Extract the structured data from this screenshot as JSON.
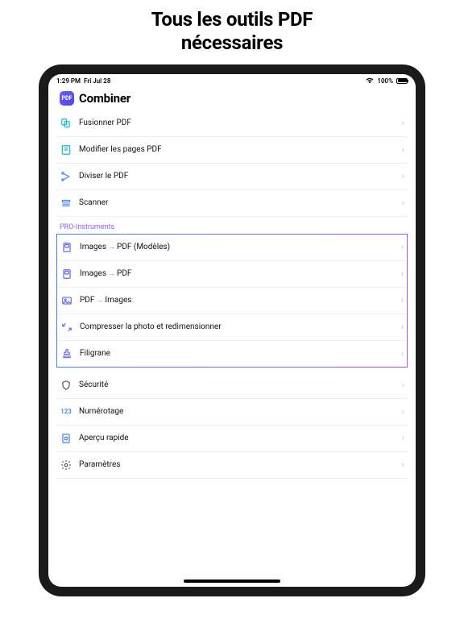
{
  "promo": {
    "title_line1": "Tous les outils PDF",
    "title_line2": "nécessaires"
  },
  "status": {
    "time": "1:29 PM",
    "date": "Fri Jul 28",
    "battery_pct": "100%"
  },
  "app": {
    "title": "Combiner",
    "icon_label": "PDF"
  },
  "basic_tools": [
    {
      "id": "merge",
      "label": "Fusionner PDF",
      "icon": "merge-icon"
    },
    {
      "id": "edit",
      "label": "Modifier les pages PDF",
      "icon": "edit-pages-icon"
    },
    {
      "id": "split",
      "label": "Diviser le PDF",
      "icon": "split-icon"
    },
    {
      "id": "scan",
      "label": "Scanner",
      "icon": "scanner-icon"
    }
  ],
  "pro_section": {
    "label": "PRO-Instruments",
    "tools": [
      {
        "id": "img2pdf_tpl",
        "label_a": "Images",
        "label_b": "PDF  (Modèles)",
        "icon": "image-doc-icon"
      },
      {
        "id": "img2pdf",
        "label_a": "Images",
        "label_b": "PDF",
        "icon": "image-doc-icon"
      },
      {
        "id": "pdf2img",
        "label_a": "PDF",
        "label_b": "Images",
        "icon": "picture-icon"
      },
      {
        "id": "compress",
        "label": "Compresser la photo et redimensionner",
        "icon": "compress-icon"
      },
      {
        "id": "watermark",
        "label": "Filigrane",
        "icon": "stamp-icon"
      }
    ]
  },
  "more_tools": [
    {
      "id": "security",
      "label": "Sécurité",
      "icon": "shield-icon"
    },
    {
      "id": "number",
      "label": "Numérotage",
      "icon": "number-icon",
      "icon_text": "123"
    },
    {
      "id": "preview",
      "label": "Aperçu rapide",
      "icon": "preview-icon"
    },
    {
      "id": "settings",
      "label": "Paramètres",
      "icon": "gear-icon"
    }
  ]
}
